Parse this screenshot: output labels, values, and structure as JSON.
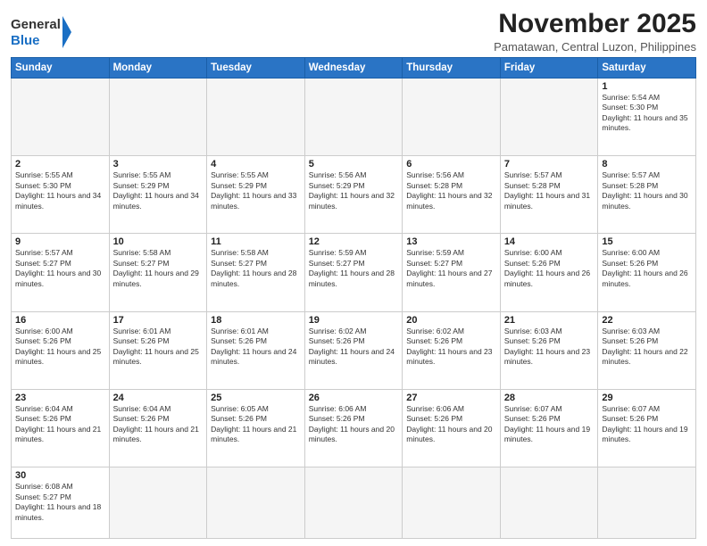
{
  "header": {
    "logo_general": "General",
    "logo_blue": "Blue",
    "month_title": "November 2025",
    "location": "Pamatawan, Central Luzon, Philippines"
  },
  "weekdays": [
    "Sunday",
    "Monday",
    "Tuesday",
    "Wednesday",
    "Thursday",
    "Friday",
    "Saturday"
  ],
  "weeks": [
    [
      {
        "day": "",
        "empty": true
      },
      {
        "day": "",
        "empty": true
      },
      {
        "day": "",
        "empty": true
      },
      {
        "day": "",
        "empty": true
      },
      {
        "day": "",
        "empty": true
      },
      {
        "day": "",
        "empty": true
      },
      {
        "day": "1",
        "sunrise": "5:54 AM",
        "sunset": "5:30 PM",
        "daylight": "11 hours and 35 minutes."
      }
    ],
    [
      {
        "day": "2",
        "sunrise": "5:55 AM",
        "sunset": "5:30 PM",
        "daylight": "11 hours and 34 minutes."
      },
      {
        "day": "3",
        "sunrise": "5:55 AM",
        "sunset": "5:29 PM",
        "daylight": "11 hours and 34 minutes."
      },
      {
        "day": "4",
        "sunrise": "5:55 AM",
        "sunset": "5:29 PM",
        "daylight": "11 hours and 33 minutes."
      },
      {
        "day": "5",
        "sunrise": "5:56 AM",
        "sunset": "5:29 PM",
        "daylight": "11 hours and 32 minutes."
      },
      {
        "day": "6",
        "sunrise": "5:56 AM",
        "sunset": "5:28 PM",
        "daylight": "11 hours and 32 minutes."
      },
      {
        "day": "7",
        "sunrise": "5:57 AM",
        "sunset": "5:28 PM",
        "daylight": "11 hours and 31 minutes."
      },
      {
        "day": "8",
        "sunrise": "5:57 AM",
        "sunset": "5:28 PM",
        "daylight": "11 hours and 30 minutes."
      }
    ],
    [
      {
        "day": "9",
        "sunrise": "5:57 AM",
        "sunset": "5:27 PM",
        "daylight": "11 hours and 30 minutes."
      },
      {
        "day": "10",
        "sunrise": "5:58 AM",
        "sunset": "5:27 PM",
        "daylight": "11 hours and 29 minutes."
      },
      {
        "day": "11",
        "sunrise": "5:58 AM",
        "sunset": "5:27 PM",
        "daylight": "11 hours and 28 minutes."
      },
      {
        "day": "12",
        "sunrise": "5:59 AM",
        "sunset": "5:27 PM",
        "daylight": "11 hours and 28 minutes."
      },
      {
        "day": "13",
        "sunrise": "5:59 AM",
        "sunset": "5:27 PM",
        "daylight": "11 hours and 27 minutes."
      },
      {
        "day": "14",
        "sunrise": "6:00 AM",
        "sunset": "5:26 PM",
        "daylight": "11 hours and 26 minutes."
      },
      {
        "day": "15",
        "sunrise": "6:00 AM",
        "sunset": "5:26 PM",
        "daylight": "11 hours and 26 minutes."
      }
    ],
    [
      {
        "day": "16",
        "sunrise": "6:00 AM",
        "sunset": "5:26 PM",
        "daylight": "11 hours and 25 minutes."
      },
      {
        "day": "17",
        "sunrise": "6:01 AM",
        "sunset": "5:26 PM",
        "daylight": "11 hours and 25 minutes."
      },
      {
        "day": "18",
        "sunrise": "6:01 AM",
        "sunset": "5:26 PM",
        "daylight": "11 hours and 24 minutes."
      },
      {
        "day": "19",
        "sunrise": "6:02 AM",
        "sunset": "5:26 PM",
        "daylight": "11 hours and 24 minutes."
      },
      {
        "day": "20",
        "sunrise": "6:02 AM",
        "sunset": "5:26 PM",
        "daylight": "11 hours and 23 minutes."
      },
      {
        "day": "21",
        "sunrise": "6:03 AM",
        "sunset": "5:26 PM",
        "daylight": "11 hours and 23 minutes."
      },
      {
        "day": "22",
        "sunrise": "6:03 AM",
        "sunset": "5:26 PM",
        "daylight": "11 hours and 22 minutes."
      }
    ],
    [
      {
        "day": "23",
        "sunrise": "6:04 AM",
        "sunset": "5:26 PM",
        "daylight": "11 hours and 21 minutes."
      },
      {
        "day": "24",
        "sunrise": "6:04 AM",
        "sunset": "5:26 PM",
        "daylight": "11 hours and 21 minutes."
      },
      {
        "day": "25",
        "sunrise": "6:05 AM",
        "sunset": "5:26 PM",
        "daylight": "11 hours and 21 minutes."
      },
      {
        "day": "26",
        "sunrise": "6:06 AM",
        "sunset": "5:26 PM",
        "daylight": "11 hours and 20 minutes."
      },
      {
        "day": "27",
        "sunrise": "6:06 AM",
        "sunset": "5:26 PM",
        "daylight": "11 hours and 20 minutes."
      },
      {
        "day": "28",
        "sunrise": "6:07 AM",
        "sunset": "5:26 PM",
        "daylight": "11 hours and 19 minutes."
      },
      {
        "day": "29",
        "sunrise": "6:07 AM",
        "sunset": "5:26 PM",
        "daylight": "11 hours and 19 minutes."
      }
    ],
    [
      {
        "day": "30",
        "sunrise": "6:08 AM",
        "sunset": "5:27 PM",
        "daylight": "11 hours and 18 minutes."
      },
      {
        "day": "",
        "empty": true
      },
      {
        "day": "",
        "empty": true
      },
      {
        "day": "",
        "empty": true
      },
      {
        "day": "",
        "empty": true
      },
      {
        "day": "",
        "empty": true
      },
      {
        "day": "",
        "empty": true
      }
    ]
  ],
  "labels": {
    "sunrise": "Sunrise:",
    "sunset": "Sunset:",
    "daylight": "Daylight:"
  }
}
